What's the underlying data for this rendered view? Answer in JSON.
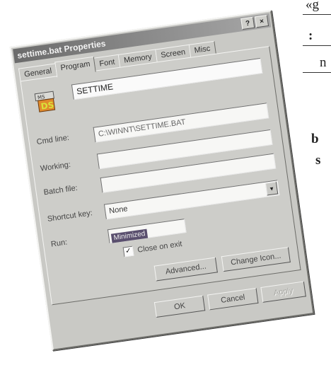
{
  "background_text": {
    "frag1": "«g",
    "frag2": ":",
    "frag3": "n",
    "frag4": "b",
    "frag5": "s"
  },
  "dialog": {
    "title": "settime.bat Properties",
    "help_btn": "?",
    "close_btn": "×",
    "tabs": [
      {
        "label": "General"
      },
      {
        "label": "Program"
      },
      {
        "label": "Font"
      },
      {
        "label": "Memory"
      },
      {
        "label": "Screen"
      },
      {
        "label": "Misc"
      }
    ],
    "active_tab": "Program",
    "program": {
      "name": "SETTIME",
      "icon": "ms-dos-program-icon",
      "cmd_label": "Cmd line:",
      "cmd_value": "C:\\WINNT\\SETTIME.BAT",
      "working_label": "Working:",
      "working_value": "",
      "batch_label": "Batch file:",
      "batch_value": "",
      "shortcut_label": "Shortcut key:",
      "shortcut_value": "None",
      "run_label": "Run:",
      "run_value": "Minimized",
      "close_on_exit_label": "Close on exit",
      "close_on_exit_checked": true
    },
    "buttons": {
      "advanced": "Advanced...",
      "change_icon": "Change Icon...",
      "ok": "OK",
      "cancel": "Cancel",
      "apply": "Apply"
    }
  }
}
